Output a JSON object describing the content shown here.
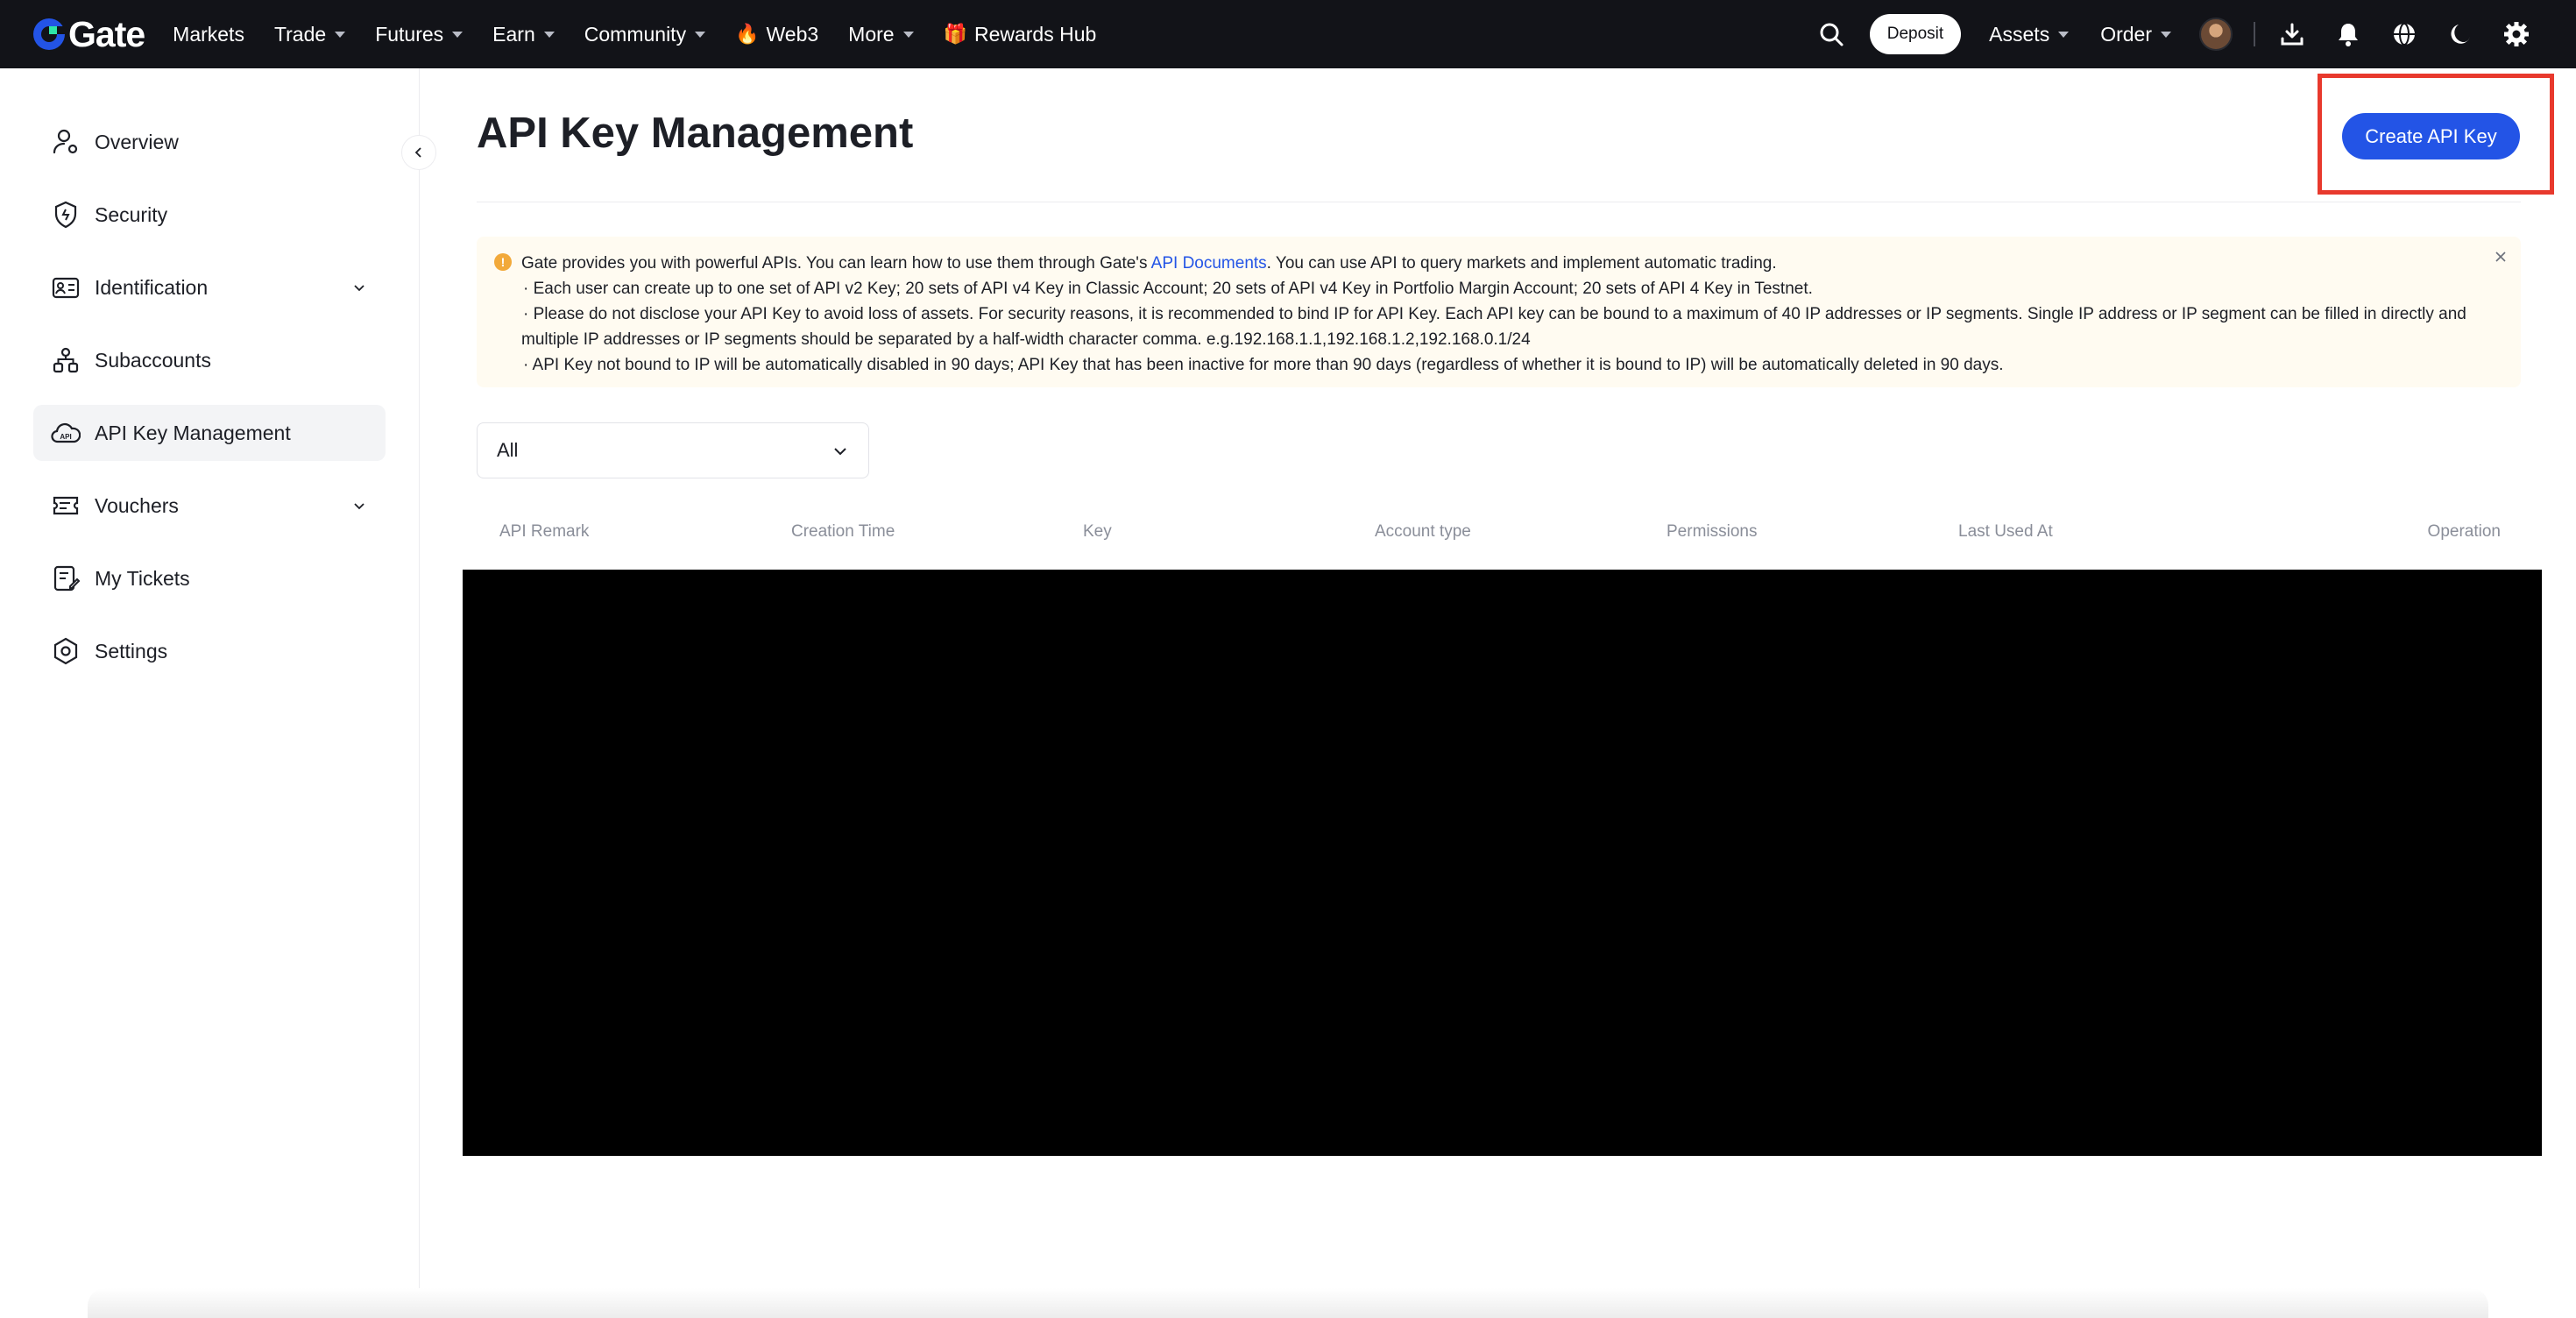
{
  "brand": {
    "logo_text": "Gate"
  },
  "nav": {
    "items": [
      {
        "label": "Markets",
        "caret": false
      },
      {
        "label": "Trade",
        "caret": true
      },
      {
        "label": "Futures",
        "caret": true
      },
      {
        "label": "Earn",
        "caret": true
      },
      {
        "label": "Community",
        "caret": true
      },
      {
        "label": "Web3",
        "caret": false,
        "emoji": "🔥"
      },
      {
        "label": "More",
        "caret": true
      },
      {
        "label": "Rewards Hub",
        "caret": false,
        "emoji": "🎁"
      }
    ],
    "deposit_label": "Deposit",
    "assets_label": "Assets",
    "order_label": "Order"
  },
  "sidebar": {
    "items": [
      {
        "label": "Overview",
        "icon": "user-icon"
      },
      {
        "label": "Security",
        "icon": "shield-icon"
      },
      {
        "label": "Identification",
        "icon": "id-card-icon",
        "expandable": true
      },
      {
        "label": "Subaccounts",
        "icon": "subaccounts-icon"
      },
      {
        "label": "API Key Management",
        "icon": "api-icon",
        "active": true
      },
      {
        "label": "Vouchers",
        "icon": "voucher-icon",
        "expandable": true
      },
      {
        "label": "My Tickets",
        "icon": "ticket-icon"
      },
      {
        "label": "Settings",
        "icon": "settings-icon"
      }
    ]
  },
  "main": {
    "title": "API Key Management",
    "create_button": "Create API Key",
    "notice": {
      "line1_pre": "Gate provides you with powerful APIs. You can learn how to use them through Gate's ",
      "line1_link": "API Documents",
      "line1_post": ". You can use API to query markets and implement automatic trading.",
      "line2": "· Each user can create up to one set of API v2 Key; 20 sets of API v4 Key in Classic Account; 20 sets of API v4 Key in Portfolio Margin Account; 20 sets of API 4 Key in Testnet.",
      "line3": "· Please do not disclose your API Key to avoid loss of assets. For security reasons, it is recommended to bind IP for API Key. Each API key can be bound to a maximum of 40 IP addresses or IP segments. Single IP address or IP segment can be filled in directly and",
      "line4": "multiple IP addresses or IP segments should be separated by a half-width character comma. e.g.192.168.1.1,192.168.1.2,192.168.0.1/24",
      "line5": "· API Key not bound to IP will be automatically disabled in 90 days; API Key that has been inactive for more than 90 days (regardless of whether it is bound to IP) will be automatically deleted in 90 days."
    },
    "filter_value": "All",
    "table_headers": [
      "API Remark",
      "Creation Time",
      "Key",
      "Account type",
      "Permissions",
      "Last Used At",
      "Operation"
    ]
  },
  "colors": {
    "topbar": "#121318",
    "accent": "#2354e6",
    "highlight": "#e8392d",
    "notice_bg": "#fffbf1"
  }
}
